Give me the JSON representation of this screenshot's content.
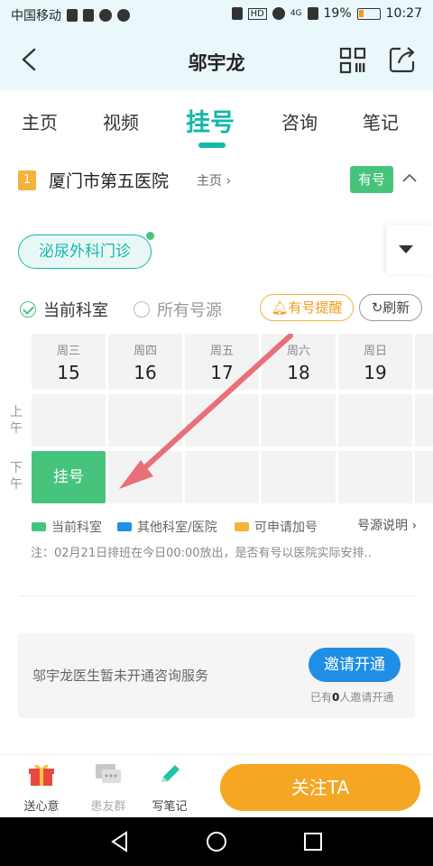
{
  "status_bar": {
    "carrier": "中国移动",
    "hd": "HD",
    "net": "4G",
    "battery": "19%",
    "time": "10:27"
  },
  "nav": {
    "title": "邬宇龙"
  },
  "tabs": [
    {
      "label": "主页",
      "active": false
    },
    {
      "label": "视频",
      "active": false
    },
    {
      "label": "挂号",
      "active": true
    },
    {
      "label": "咨询",
      "active": false
    },
    {
      "label": "笔记",
      "active": false
    }
  ],
  "hospital": {
    "index": "1",
    "name": "厦门市第五医院",
    "home_link": "主页",
    "availability": "有号"
  },
  "department": {
    "name": "泌尿外科门诊"
  },
  "filter": {
    "current_dept": "当前科室",
    "all_sources": "所有号源",
    "remind": "有号提醒",
    "refresh": "刷新"
  },
  "schedule": {
    "days": [
      {
        "weekday": "周三",
        "date": "15"
      },
      {
        "weekday": "周四",
        "date": "16"
      },
      {
        "weekday": "周五",
        "date": "17"
      },
      {
        "weekday": "周六",
        "date": "18"
      },
      {
        "weekday": "周日",
        "date": "19"
      }
    ],
    "am_label": "上午",
    "pm_label": "下午",
    "book_label": "挂号"
  },
  "legend": {
    "items": [
      {
        "label": "当前科室",
        "color": "#47c47c"
      },
      {
        "label": "其他科室/医院",
        "color": "#1f8fe5"
      },
      {
        "label": "可申请加号",
        "color": "#f4b33a"
      }
    ],
    "explain": "号源说明"
  },
  "note": "注：02月21日排班在今日00:00放出，是否有号以医院实际安排..",
  "consult": {
    "message": "邬宇龙医生暂未开通咨询服务",
    "invite_button": "邀请开通",
    "count_prefix": "已有",
    "count": "0",
    "count_suffix": "人邀请开通"
  },
  "bottom_bar": {
    "gift": "送心意",
    "group": "患友群",
    "note": "写笔记",
    "follow": "关注TA"
  },
  "colors": {
    "accent": "#13b8a8",
    "green": "#47c47c",
    "orange": "#f5a623",
    "blue": "#1f8fe5"
  }
}
